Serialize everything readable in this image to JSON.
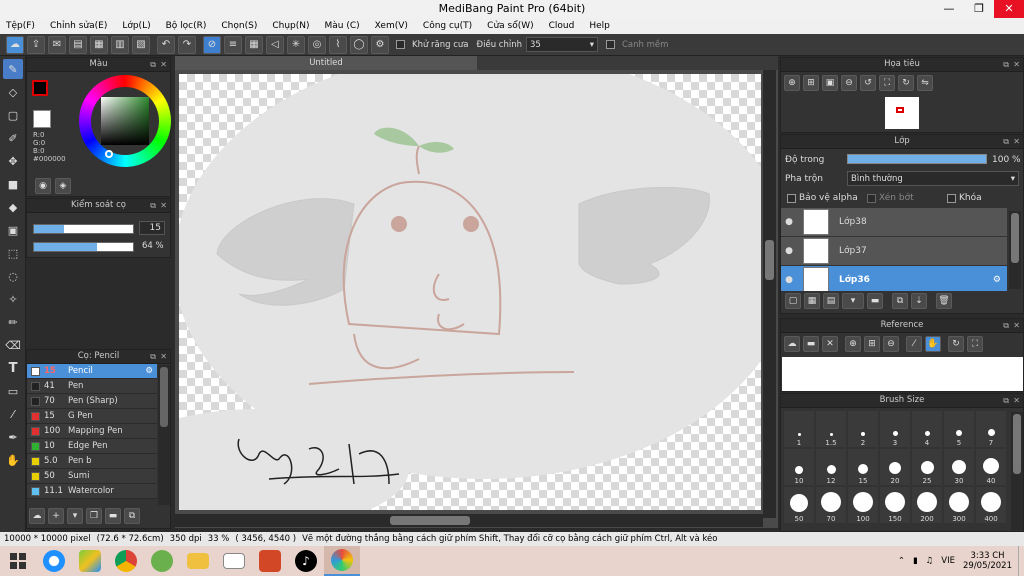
{
  "window": {
    "title": "MediBang Paint Pro (64bit)",
    "min": "—",
    "max": "❐",
    "close": "✕"
  },
  "menu": [
    "Tệp(F)",
    "Chỉnh sửa(E)",
    "Lớp(L)",
    "Bộ lọc(R)",
    "Chọn(S)",
    "Chụp(N)",
    "Màu (C)",
    "Xem(V)",
    "Công cụ(T)",
    "Cửa sổ(W)",
    "Cloud",
    "Help"
  ],
  "toolbar": {
    "antialias_label": "Khử răng cưa",
    "correction_label": "Điều chỉnh",
    "correction_value": "35",
    "canh_mem_label": "Canh mềm"
  },
  "color_panel": {
    "title": "Màu",
    "r": "R:0",
    "g": "G:0",
    "b": "B:0",
    "hex": "#000000",
    "foreground": "#000000"
  },
  "brush_control": {
    "title": "Kiểm soát cọ",
    "size": "15",
    "size_fraction": 0.3,
    "opacity": "64 %",
    "opacity_fraction": 0.64
  },
  "brush_panel": {
    "title": "Cọ: Pencil",
    "items": [
      {
        "num": "15",
        "name": "Pencil",
        "color": "#ffffff",
        "selected": true
      },
      {
        "num": "41",
        "name": "Pen",
        "color": "#222222"
      },
      {
        "num": "70",
        "name": "Pen (Sharp)",
        "color": "#222222"
      },
      {
        "num": "15",
        "name": "G Pen",
        "color": "#e03030"
      },
      {
        "num": "100",
        "name": "Mapping Pen",
        "color": "#e03030"
      },
      {
        "num": "10",
        "name": "Edge Pen",
        "color": "#30b030"
      },
      {
        "num": "5.0",
        "name": "Pen b",
        "color": "#e8d000"
      },
      {
        "num": "50",
        "name": "Sumi",
        "color": "#e8d000"
      },
      {
        "num": "11.1",
        "name": "Watercolor",
        "color": "#60c0f0"
      }
    ]
  },
  "canvas": {
    "tab": "Untitled"
  },
  "navigator": {
    "title": "Họa tiêu"
  },
  "layer_panel": {
    "title": "Lớp",
    "opacity_label": "Độ trong",
    "opacity_value": "100 %",
    "blend_label": "Pha trộn",
    "blend_value": "Bình thường",
    "protect_alpha": "Bảo vệ alpha",
    "clipping": "Xén bớt",
    "lock": "Khóa",
    "layers": [
      {
        "name": "Lớp38"
      },
      {
        "name": "Lớp37"
      },
      {
        "name": "Lớp36",
        "selected": true
      }
    ]
  },
  "reference": {
    "title": "Reference"
  },
  "brush_size": {
    "title": "Brush Size",
    "row1": [
      "1",
      "1.5",
      "2",
      "3",
      "4",
      "5",
      "7"
    ],
    "row2": [
      "10",
      "12",
      "15",
      "20",
      "25",
      "30",
      "40"
    ],
    "row3": [
      "50",
      "70",
      "100",
      "150",
      "200",
      "300",
      "400"
    ]
  },
  "status": {
    "size": "10000 * 10000 pixel",
    "cm": "(72.6 * 72.6cm)",
    "dpi": "350 dpi",
    "zoom": "33 %",
    "coords": "( 3456, 4540 )",
    "hint": "Vẽ một đường thẳng bằng cách giữ phím Shift, Thay đổi cỡ cọ bằng cách giữ phím Ctrl, Alt và kéo"
  },
  "taskbar": {
    "lang": "VIE",
    "time": "3:33 CH",
    "date": "29/05/2021"
  },
  "colors": {
    "accent": "#4a90d8",
    "panel_bg": "#333333",
    "taskbar_bg": "#e8d4cc"
  }
}
